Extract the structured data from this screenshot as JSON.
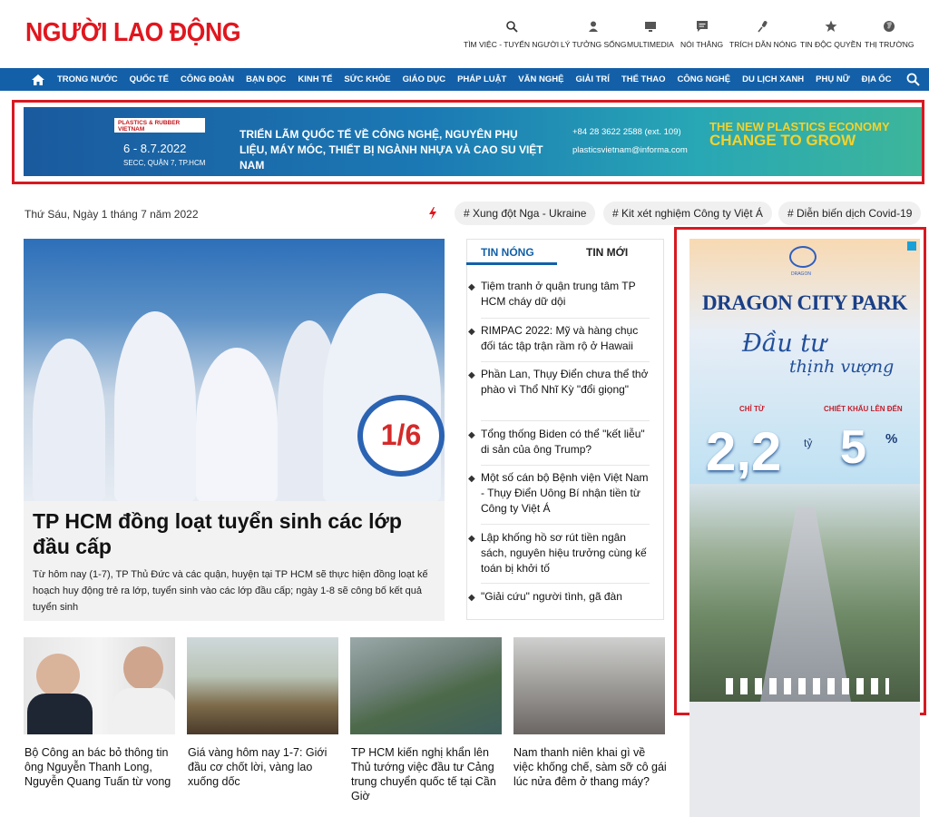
{
  "site": {
    "logo_text": "NGƯỜI LAO ĐỘNG",
    "brand_red": "#e0161e",
    "nav_blue": "#1360a8"
  },
  "quick_links": [
    {
      "label": "TÌM VIỆC - TUYỂN NGƯỜI",
      "icon": "search-icon"
    },
    {
      "label": "LÝ TƯỞNG SỐNG",
      "icon": "person-icon"
    },
    {
      "label": "MULTIMEDIA",
      "icon": "monitor-icon"
    },
    {
      "label": "NÓI THẲNG",
      "icon": "chat-icon"
    },
    {
      "label": "TRÍCH DẪN NÓNG",
      "icon": "microphone-icon"
    },
    {
      "label": "TIN ĐỘC QUYỀN",
      "icon": "star-icon"
    },
    {
      "label": "THỊ TRƯỜNG",
      "icon": "globe-icon"
    }
  ],
  "nav": [
    "TRONG NƯỚC",
    "QUỐC TẾ",
    "CÔNG ĐOÀN",
    "BẠN ĐỌC",
    "KINH TẾ",
    "SỨC KHỎE",
    "GIÁO DỤC",
    "PHÁP LUẬT",
    "VĂN NGHỆ",
    "GIẢI TRÍ",
    "THỂ THAO",
    "CÔNG NGHỆ",
    "DU LỊCH XANH",
    "PHỤ NỮ",
    "ĐỊA ỐC"
  ],
  "banner": {
    "brand": "PLASTICS & RUBBER VIETNAM",
    "date": "6 - 8.7.2022",
    "venue": "SECC, QUẬN 7, TP.HCM",
    "headline": "TRIỂN LÃM QUỐC TẾ VỀ CÔNG NGHỆ, NGUYÊN PHỤ LIỆU, MÁY MÓC, THIẾT BỊ NGÀNH NHỰA VÀ CAO SU VIỆT NAM",
    "phone": "+84 28 3622 2588 (ext. 109)",
    "email": "plasticsvietnam@informa.com",
    "slogan_top": "THE NEW PLASTICS ECONOMY",
    "slogan_bottom": "CHANGE TO GROW"
  },
  "dateline": "Thứ Sáu, Ngày 1 tháng 7 năm 2022",
  "tags": [
    "# Xung đột Nga - Ukraine",
    "# Kit xét nghiệm Công ty Việt Á",
    "# Diễn biến dịch Covid-19"
  ],
  "hero": {
    "title": "TP HCM đồng loạt tuyển sinh các lớp đầu cấp",
    "summary": "Từ hôm nay (1-7), TP Thủ Đức và các quận, huyện tại TP HCM sẽ thực hiện đồng loạt kế hoạch huy động trẻ ra lớp, tuyển sinh vào các lớp đầu cấp; ngày 1-8 sẽ công bố kết quả tuyển sinh",
    "sign_text": "1/6"
  },
  "hot_tabs": {
    "active": "TIN NÓNG",
    "inactive": "TIN MỚI"
  },
  "hot_news": [
    "Tiệm tranh ở quận trung tâm TP HCM cháy dữ dội",
    "RIMPAC 2022: Mỹ và hàng chục đối tác tập trận rầm rộ ở Hawaii",
    "Phần Lan, Thụy Điển chưa thể thở phào vì Thổ Nhĩ Kỳ \"đổi giọng\"",
    "Tổng thống Biden có thể \"kết liễu\" di sản của ông Trump?",
    "Một số cán bộ Bệnh viện Việt Nam - Thụy Điển Uông Bí nhận tiền từ Công ty Việt Á",
    "Lập khống hồ sơ rút tiền ngân sách, nguyên hiệu trưởng cùng kế toán bị khởi tố",
    "\"Giải cứu\" người tình, gã đàn"
  ],
  "side_ad": {
    "logo_text": "DRAGON",
    "name": "DRAGON CITY PARK",
    "tagline_1": "Đầu tư",
    "tagline_2": "thịnh vượng",
    "label_1": "CHỈ TỪ",
    "label_2": "CHIẾT KHẤU LÊN ĐẾN",
    "value_1": "2,2",
    "unit_1": "tỷ",
    "value_2": "5",
    "unit_2": "%"
  },
  "bottom_stories": [
    "Bộ Công an bác bỏ thông tin ông Nguyễn Thanh Long, Nguyễn Quang Tuấn từ vong",
    "Giá vàng hôm nay 1-7: Giới đầu cơ chốt lời, vàng lao xuống dốc",
    "TP HCM kiến nghị khẩn lên Thủ tướng việc đầu tư Cảng trung chuyển quốc tế tại Cần Giờ",
    "Nam thanh niên khai gì về việc khống chế, sàm sỡ cô gái lúc nửa đêm ở thang máy?"
  ]
}
